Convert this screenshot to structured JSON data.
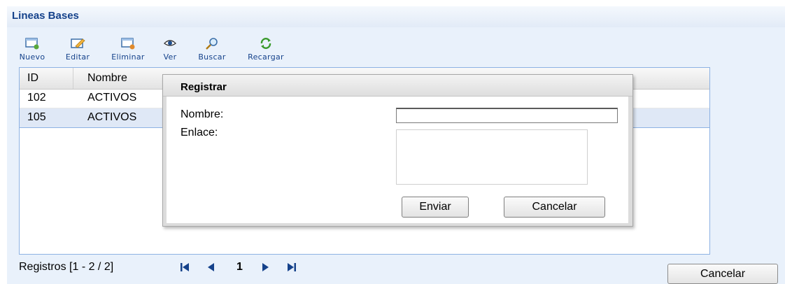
{
  "panel": {
    "title": "Lineas Bases"
  },
  "toolbar": {
    "buttons": [
      {
        "label": "Nuevo",
        "icon": "new-document-icon"
      },
      {
        "label": "Editar",
        "icon": "edit-icon"
      },
      {
        "label": "Eliminar",
        "icon": "delete-icon"
      },
      {
        "label": "Ver",
        "icon": "view-eye-icon"
      },
      {
        "label": "Buscar",
        "icon": "search-icon"
      },
      {
        "label": "Recargar",
        "icon": "reload-icon"
      }
    ]
  },
  "grid": {
    "columns": [
      "ID",
      "Nombre"
    ],
    "rows": [
      {
        "id": "102",
        "nombre": "ACTIVOS"
      },
      {
        "id": "105",
        "nombre": "ACTIVOS"
      }
    ]
  },
  "pager": {
    "text": "Registros [1 - 2 / 2]",
    "page": "1",
    "first_icon": "first-page-icon",
    "prev_icon": "previous-page-icon",
    "next_icon": "next-page-icon",
    "last_icon": "last-page-icon"
  },
  "outer_cancel_label": "Cancelar",
  "dialog": {
    "title": "Registrar",
    "nombre_label": "Nombre:",
    "nombre_value": "",
    "enlace_label": "Enlace:",
    "enlace_value": "",
    "submit_label": "Enviar",
    "cancel_label": "Cancelar"
  },
  "colors": {
    "header_text": "#15428b",
    "panel_bg": "#e9f1fb",
    "grid_border": "#8db2e3",
    "selected_row": "#dfe8f6"
  }
}
